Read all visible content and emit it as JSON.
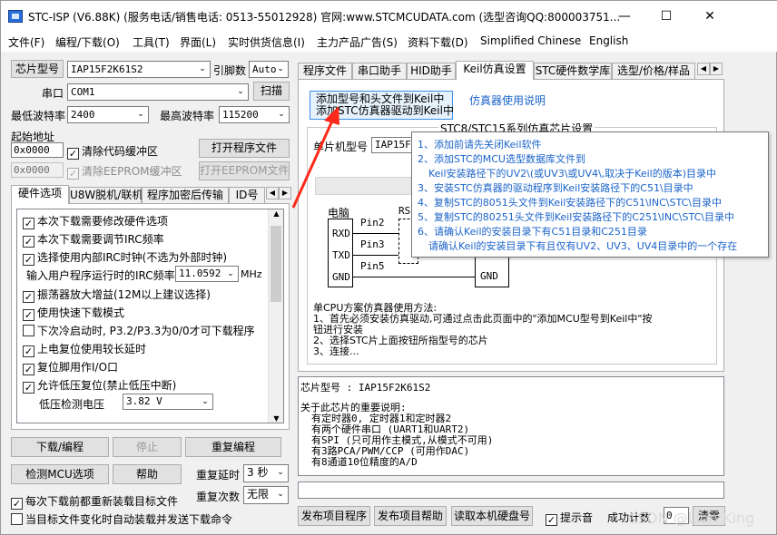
{
  "window": {
    "title": "STC-ISP (V6.88K) (服务电话/销售电话: 0513-55012928) 官网:www.STCMCUDATA.com  (选型咨询QQ:800003751...",
    "minimize": "—",
    "maximize": "☐",
    "close": "✕"
  },
  "menu": [
    "文件(F)",
    "编程/下载(O)",
    "工具(T)",
    "界面(L)",
    "实时供货信息(I)",
    "主力产品广告(S)",
    "资料下载(D)",
    "Simplified Chinese",
    "English"
  ],
  "left": {
    "chip_model_btn": "芯片型号",
    "chip_model_value": "IAP15F2K61S2",
    "pin_count_label": "引脚数",
    "pin_count_value": "Auto",
    "port_label": "串口",
    "port_value": "COM1",
    "scan_btn": "扫描",
    "min_baud_label": "最低波特率",
    "min_baud_value": "2400",
    "max_baud_label": "最高波特率",
    "max_baud_value": "115200",
    "start_addr_label": "起始地址",
    "code_addr": "0x0000",
    "clear_code_label": "清除代码缓冲区",
    "open_prog_btn": "打开程序文件",
    "eeprom_addr": "0x0000",
    "clear_eeprom_label": "清除EEPROM缓冲区",
    "open_eeprom_btn": "打开EEPROM文件",
    "tabs": [
      "硬件选项",
      "U8W脱机/联机",
      "程序加密后传输",
      "ID号"
    ],
    "options": [
      {
        "label": "本次下载需要修改硬件选项",
        "checked": true
      },
      {
        "label": "本次下载需要调节IRC频率",
        "checked": true
      },
      {
        "label": "选择使用内部IRC时钟(不选为外部时钟)",
        "checked": true
      },
      {
        "label": "振荡器放大增益(12M以上建议选择)",
        "checked": true
      },
      {
        "label": "使用快速下载模式",
        "checked": true
      },
      {
        "label": "下次冷启动时, P3.2/P3.3为0/0才可下载程序",
        "checked": false
      },
      {
        "label": "上电复位使用较长延时",
        "checked": true
      },
      {
        "label": "复位脚用作I/O口",
        "checked": true
      },
      {
        "label": "允许低压复位(禁止低压中断)",
        "checked": true
      }
    ],
    "irc_freq_label": "输入用户程序运行时的IRC频率",
    "irc_freq_value": "11.0592",
    "irc_unit": "MHz",
    "lv_label": "低压检测电压",
    "lv_value": "3.82 V",
    "download_btn": "下载/编程",
    "stop_btn": "停止",
    "reprog_btn": "重复编程",
    "detect_btn": "检测MCU选项",
    "help_btn": "帮助",
    "repeat_delay_label": "重复延时",
    "repeat_delay_value": "3 秒",
    "repeat_count_label": "重复次数",
    "repeat_count_value": "无限",
    "reload_label": "每次下载前都重新装载目标文件",
    "reload_checked": true,
    "autoload_label": "当目标文件变化时自动装载并发送下载命令",
    "autoload_checked": false
  },
  "right": {
    "tabs": [
      "程序文件",
      "串口助手",
      "HID助手",
      "Keil仿真设置",
      "STC硬件数学库",
      "选型/价格/样品"
    ],
    "add_keil_line1": "添加型号和头文件到Keil中",
    "add_keil_line2": "添加STC仿真器驱动到Keil中",
    "emu_link": "仿真器使用说明",
    "group_title": "STC8/STC15系列仿真芯片设置",
    "mcu_model_label": "单片机型号",
    "mcu_model_value": "IAP15F",
    "circuit": {
      "pc": "电脑",
      "rxd": "RXD",
      "txd": "TXD",
      "gnd": "GND",
      "pin2": "Pin2",
      "pin3": "Pin3",
      "pin5": "Pin5",
      "rs": "RS",
      "gnd2": "GND"
    },
    "single_cpu_title": "单CPU方案仿真器使用方法:",
    "single_cpu_lines": [
      "1、首先必须安装仿真驱动,可通过点击此页面中的\"添加MCU型号到Keil中\"按",
      "钮进行安装",
      "2、选择STC片上面按钮所指型号的芯片",
      "3、连接..."
    ],
    "info_chip_line": "芯片型号 : IAP15F2K61S2",
    "info_lines": [
      "关于此芯片的重要说明:",
      "有定时器0, 定时器1和定时器2",
      "有两个硬件串口 (UART1和UART2)",
      "有SPI (只可用作主模式,从模式不可用)",
      "有3路PCA/PWM/CCP (可用作DAC)",
      "有8通道10位精度的A/D"
    ],
    "publish_btn": "发布项目程序",
    "publish_help_btn": "发布项目帮助",
    "read_disk_btn": "读取本机硬盘号",
    "beep_label": "提示音",
    "beep_checked": true,
    "success_label": "成功计数",
    "success_value": "0",
    "clear_btn": "清零",
    "watermark": "CSDN @Lion King"
  },
  "tooltip": [
    "1、添加前请先关闭Keil软件",
    "2、添加STC的MCU选型数据库文件到",
    "Keil安装路径下的UV2\\(或UV3\\或UV4\\,取决于Keil的版本)目录中",
    "3、安装STC仿真器的驱动程序到Keil安装路径下的C51\\目录中",
    "4、复制STC的8051头文件到Keil安装路径下的C51\\INC\\STC\\目录中",
    "5、复制STC的80251头文件到Keil安装路径下的C251\\INC\\STC\\目录中",
    "6、请确认Keil的安装目录下有C51目录和C251目录",
    "请确认Keil的安装目录下有且仅有UV2、UV3、UV4目录中的一个存在"
  ],
  "colors": {
    "link": "#1a63c9",
    "annotation_arrow": "#ff2a1a",
    "highlight_box": "#3d8ee6"
  }
}
